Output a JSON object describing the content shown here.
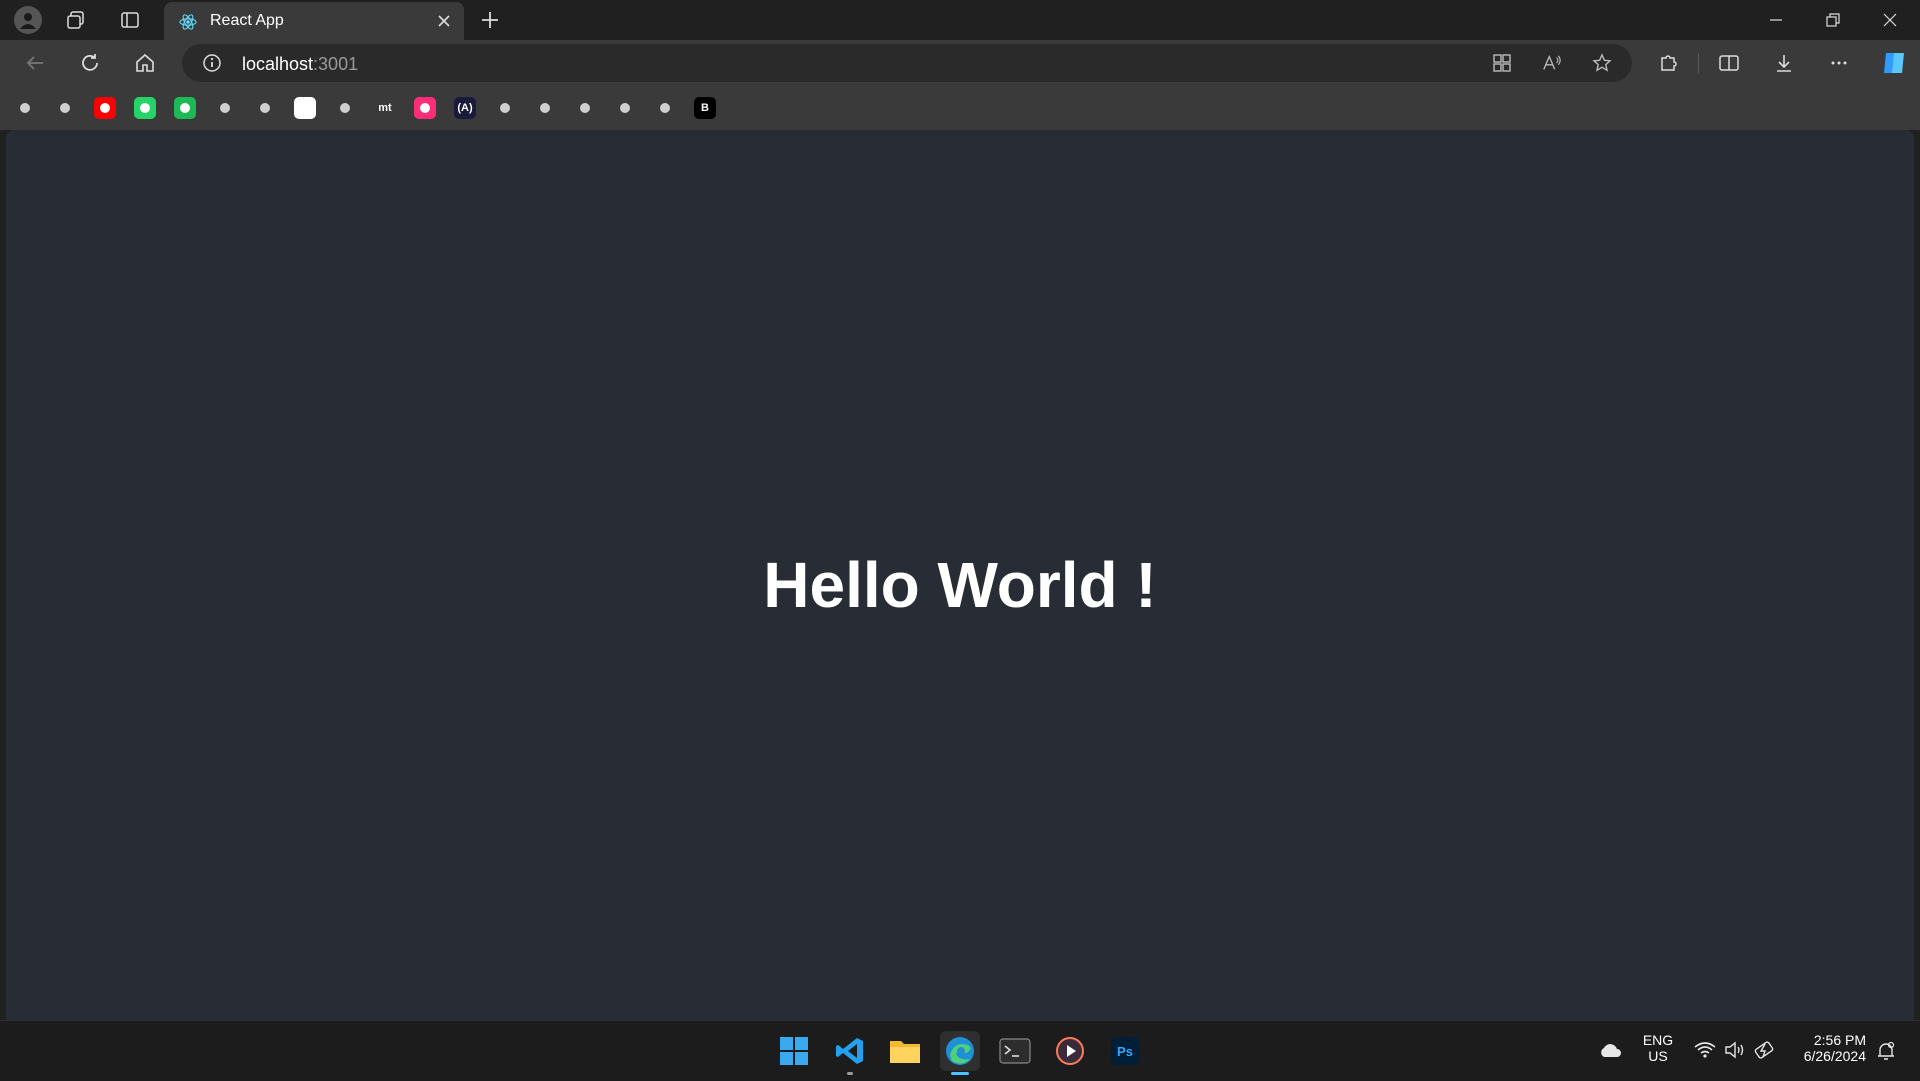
{
  "browser": {
    "tab": {
      "title": "React App"
    },
    "address": {
      "host": "localhost",
      "port": ":3001"
    }
  },
  "bookmarks": [
    {
      "icon": "file-icon",
      "color": "#3a3a3a"
    },
    {
      "icon": "google-drive-icon",
      "color": "#3a3a3a"
    },
    {
      "icon": "youtube-icon",
      "color": "#ff0000"
    },
    {
      "icon": "whatsapp-icon",
      "color": "#25d366"
    },
    {
      "icon": "spotify-icon",
      "color": "#1db954"
    },
    {
      "icon": "arrow-circle-icon",
      "color": "#3a3a3a"
    },
    {
      "icon": "geeksforgeeks-icon",
      "color": "#3a3a3a"
    },
    {
      "icon": "chatgpt-icon",
      "color": "#ffffff"
    },
    {
      "icon": "graphql-icon",
      "color": "#3a3a3a"
    },
    {
      "icon": "mt-icon",
      "color": "#3a3a3a",
      "text": "mt"
    },
    {
      "icon": "play-icon",
      "color": "#ff2d78"
    },
    {
      "icon": "code-icon",
      "color": "#1a1a3a",
      "text": "(A)"
    },
    {
      "icon": "fire-icon",
      "color": "#3a3a3a"
    },
    {
      "icon": "star-icon",
      "color": "#3a3a3a"
    },
    {
      "icon": "microsoft-icon",
      "color": "#3a3a3a"
    },
    {
      "icon": "stackoverflow-icon",
      "color": "#3a3a3a"
    },
    {
      "icon": "github-icon",
      "color": "#3a3a3a"
    },
    {
      "icon": "b-icon",
      "color": "#000000",
      "text": "B"
    }
  ],
  "page": {
    "heading": "Hello World !"
  },
  "taskbar": {
    "lang_top": "ENG",
    "lang_bottom": "US",
    "time": "2:56 PM",
    "date": "6/26/2024"
  },
  "colors": {
    "page_bg": "#282c34",
    "chrome_bg": "#3a3a3a",
    "titlebar_bg": "#202020",
    "accent": "#4cc2ff"
  }
}
